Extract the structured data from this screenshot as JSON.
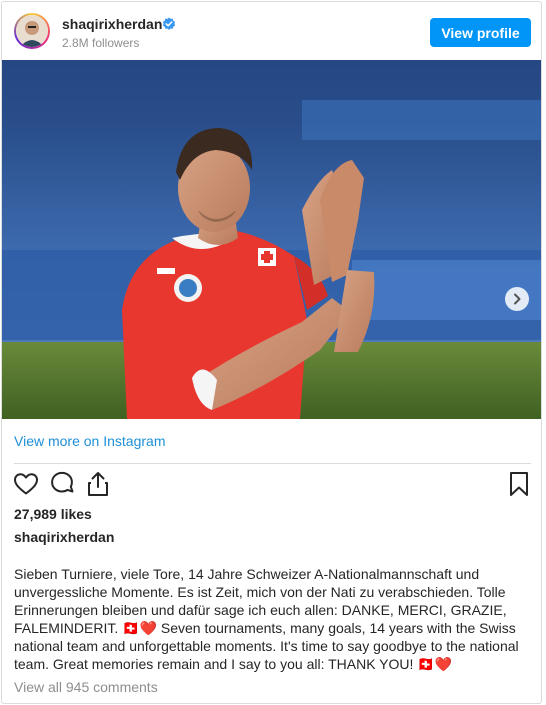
{
  "header": {
    "username": "shaqirixherdan",
    "followers": "2.8M followers",
    "view_profile_label": "View profile",
    "verified_icon": "verified-badge-icon"
  },
  "post": {
    "image_icon": "soccer-player-photo",
    "carousel": {
      "slides_shown": 2,
      "active_index": 0
    },
    "view_more_label": "View more on Instagram",
    "likes": "27,989 likes",
    "caption_username": "shaqirixherdan",
    "caption_text": "Sieben Turniere, viele Tore, 14 Jahre Schweizer A-Nationalmannschaft und unvergessliche Momente. Es ist Zeit, mich von der Nati zu verabschieden. Tolle Erinnerungen bleiben und dafür sage ich euch allen: DANKE, MERCI, GRAZIE, FALEMINDERIT. 🇨🇭❤️ Seven tournaments, many goals, 14 years with the Swiss national team and unforgettable moments. It's time to say goodbye to the national team. Great memories remain and I say to you all: THANK YOU! 🇨🇭❤️",
    "comments_label": "View all 945 comments"
  },
  "colors": {
    "accent": "#0095f6",
    "link": "#1d8fd6",
    "muted": "#8e8e8e",
    "jersey": "#e8372e"
  }
}
